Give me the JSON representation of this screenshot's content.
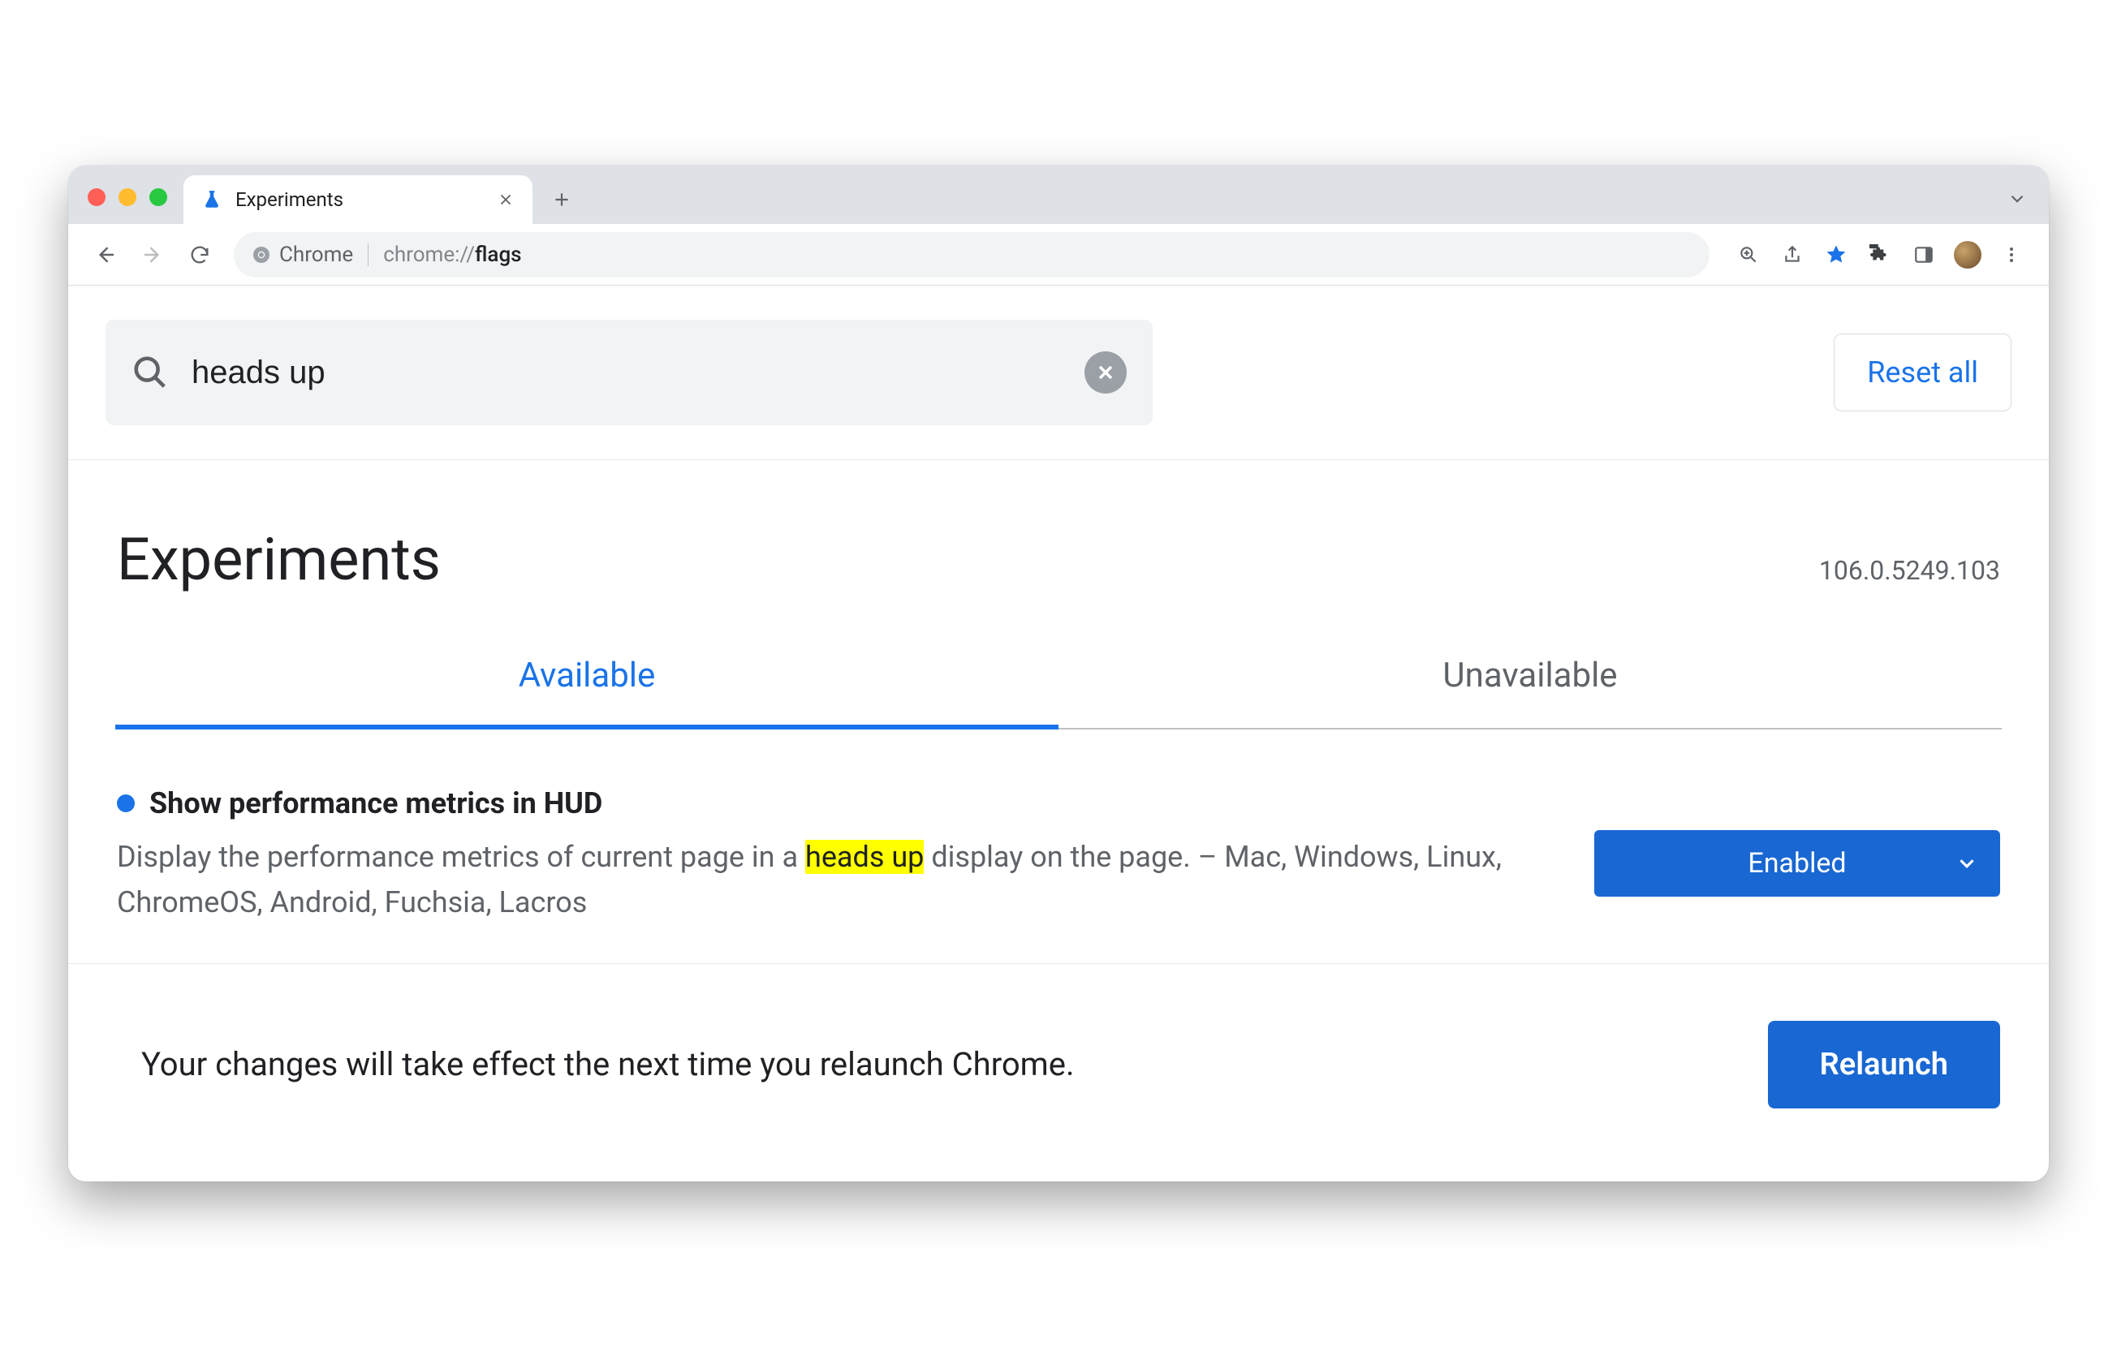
{
  "browser": {
    "tab_title": "Experiments",
    "omnibox_chip": "Chrome",
    "url_prefix": "chrome://",
    "url_path": "flags"
  },
  "search": {
    "value": "heads up",
    "reset_label": "Reset all"
  },
  "page": {
    "title": "Experiments",
    "version": "106.0.5249.103"
  },
  "tabs": {
    "available": "Available",
    "unavailable": "Unavailable"
  },
  "flag": {
    "title": "Show performance metrics in HUD",
    "desc_pre": "Display the performance metrics of current page in a ",
    "desc_hl": "heads up",
    "desc_post": " display on the page. – Mac, Windows, Linux, ChromeOS, Android, Fuchsia, Lacros",
    "select_value": "Enabled"
  },
  "relaunch": {
    "message": "Your changes will take effect the next time you relaunch Chrome.",
    "button": "Relaunch"
  }
}
